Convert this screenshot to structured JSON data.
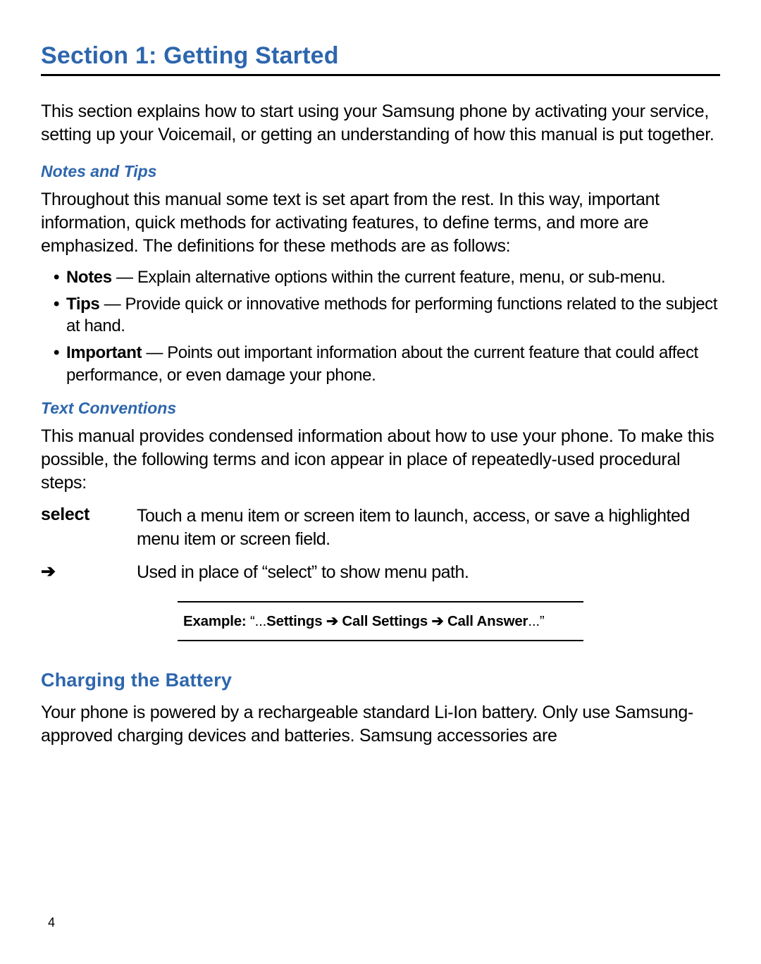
{
  "colors": {
    "accent": "#2d66ad"
  },
  "section": {
    "title": "Section 1: Getting Started",
    "intro": "This section explains how to start using your Samsung phone by activating your service, setting up your Voicemail, or getting an understanding of how this manual is put together."
  },
  "notes_tips": {
    "heading": "Notes and Tips",
    "intro": "Throughout this manual some text is set apart from the rest. In this way, important information, quick methods for activating features, to define terms, and more are emphasized. The definitions for these methods are as follows:",
    "items": [
      {
        "term": "Notes",
        "desc": " — Explain alternative options within the current feature, menu, or sub-menu."
      },
      {
        "term": "Tips",
        "desc": " — Provide quick or innovative methods for performing functions related to the subject at hand."
      },
      {
        "term": "Important",
        "desc": " — Points out important information about the current feature that could affect performance, or even damage your phone."
      }
    ]
  },
  "text_conventions": {
    "heading": "Text Conventions",
    "intro": "This manual provides condensed information about how to use your phone. To make this possible, the following terms and icon appear in place of repeatedly-used procedural steps:",
    "defs": [
      {
        "term": "select",
        "desc": "Touch a menu item or screen item to launch, access, or save a highlighted menu item or screen field."
      },
      {
        "term": "➔",
        "desc": "Used in place of “select” to show menu path."
      }
    ],
    "example": {
      "label": "Example: ",
      "quote_open": "“...",
      "path1": "Settings",
      "arrow": " ➔ ",
      "path2": "Call Settings",
      "path3": "Call Answer",
      "quote_close": "...”"
    }
  },
  "charging": {
    "heading": "Charging the Battery",
    "body": "Your phone is powered by a rechargeable standard Li-Ion battery. Only use Samsung-approved charging devices and batteries. Samsung accessories are"
  },
  "page_number": "4"
}
